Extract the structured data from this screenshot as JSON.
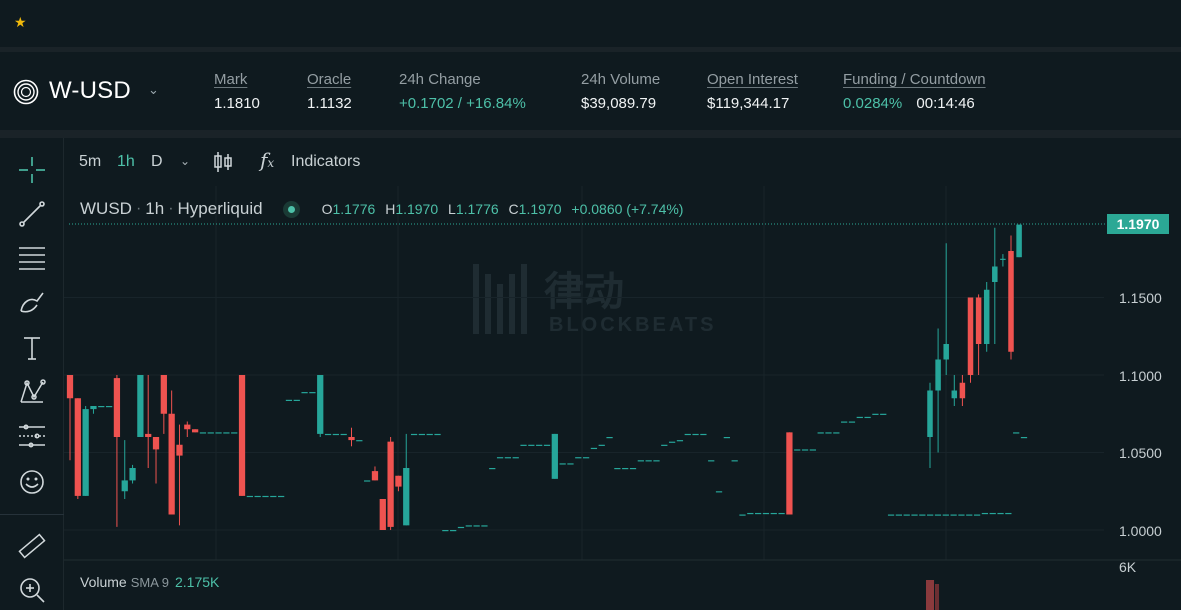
{
  "favorites": {
    "star_glyph": "★"
  },
  "market": {
    "symbol": "W-USD",
    "stats": [
      {
        "label": "Mark",
        "value": "1.1810"
      },
      {
        "label": "Oracle",
        "value": "1.1132"
      },
      {
        "label": "24h Change",
        "value": "+0.1702 / +16.84%"
      },
      {
        "label": "24h Volume",
        "value": "$39,089.79"
      },
      {
        "label": "Open Interest",
        "value": "$119,344.17"
      },
      {
        "label": "Funding / Countdown",
        "value": "0.0284%",
        "countdown": "00:14:46"
      }
    ]
  },
  "toolbar": {
    "tools": [
      "crosshair-icon",
      "trend-line-icon",
      "horizontal-lines-icon",
      "brush-icon",
      "text-icon",
      "pattern-icon",
      "prediction-icon",
      "emoji-icon",
      "ruler-icon",
      "zoom-in-icon"
    ]
  },
  "intervals": {
    "options": [
      "5m",
      "1h",
      "D"
    ],
    "active": "1h",
    "indicators_label": "Indicators"
  },
  "chart": {
    "legend": {
      "symbol": "WUSD",
      "interval": "1h",
      "exchange": "Hyperliquid",
      "o": "1.1776",
      "h": "1.1970",
      "l": "1.1776",
      "c": "1.1970",
      "change": "+0.0860 (+7.74%)"
    },
    "last_price_tag": "1.1970",
    "volume_legend": {
      "label": "Volume",
      "sma": "SMA 9",
      "value": "2.175K"
    },
    "watermark": "BLOCKBEATS",
    "watermark_cjk": "律动"
  },
  "chart_data": {
    "type": "candlestick",
    "y_ticks": [
      "1.1500",
      "1.1000",
      "1.0500",
      "1.0000"
    ],
    "volume_tick": "6K",
    "colors": {
      "up": "#26a69a",
      "down": "#ef5350"
    },
    "candles": [
      [
        1.1,
        1.1,
        1.045,
        1.085
      ],
      [
        1.085,
        1.085,
        1.02,
        1.022
      ],
      [
        1.022,
        1.08,
        1.022,
        1.078
      ],
      [
        1.078,
        1.08,
        1.075,
        1.08
      ],
      [
        1.08,
        1.08,
        1.08,
        1.08
      ],
      [
        1.08,
        1.08,
        1.08,
        1.08
      ],
      [
        1.098,
        1.1,
        1.002,
        1.06
      ],
      [
        1.025,
        1.058,
        1.02,
        1.032
      ],
      [
        1.032,
        1.042,
        1.03,
        1.04
      ],
      [
        1.06,
        1.09,
        1.06,
        1.1
      ],
      [
        1.062,
        1.1,
        1.04,
        1.06
      ],
      [
        1.06,
        1.06,
        1.03,
        1.052
      ],
      [
        1.1,
        1.1,
        1.062,
        1.075
      ],
      [
        1.075,
        1.09,
        1.01,
        1.01
      ],
      [
        1.055,
        1.068,
        1.003,
        1.048
      ],
      [
        1.068,
        1.07,
        1.06,
        1.065
      ],
      [
        1.065,
        1.065,
        1.063,
        1.063
      ],
      [
        1.063,
        1.063,
        1.063,
        1.063
      ],
      [
        1.063,
        1.063,
        1.063,
        1.063
      ],
      [
        1.063,
        1.063,
        1.063,
        1.063
      ],
      [
        1.063,
        1.063,
        1.063,
        1.063
      ],
      [
        1.063,
        1.063,
        1.063,
        1.063
      ],
      [
        1.1,
        1.1,
        1.022,
        1.022
      ],
      [
        1.022,
        1.022,
        1.022,
        1.022
      ],
      [
        1.022,
        1.022,
        1.022,
        1.022
      ],
      [
        1.022,
        1.022,
        1.022,
        1.022
      ],
      [
        1.022,
        1.022,
        1.022,
        1.022
      ],
      [
        1.022,
        1.022,
        1.022,
        1.022
      ],
      [
        1.084,
        1.084,
        1.084,
        1.084
      ],
      [
        1.084,
        1.084,
        1.084,
        1.084
      ],
      [
        1.089,
        1.089,
        1.089,
        1.089
      ],
      [
        1.089,
        1.089,
        1.089,
        1.089
      ],
      [
        1.062,
        1.1,
        1.06,
        1.1
      ],
      [
        1.062,
        1.062,
        1.062,
        1.062
      ],
      [
        1.062,
        1.062,
        1.062,
        1.062
      ],
      [
        1.062,
        1.062,
        1.062,
        1.062
      ],
      [
        1.06,
        1.066,
        1.054,
        1.058
      ],
      [
        1.058,
        1.058,
        1.058,
        1.058
      ],
      [
        1.032,
        1.032,
        1.032,
        1.032
      ],
      [
        1.038,
        1.041,
        1.032,
        1.032
      ],
      [
        1.02,
        1.02,
        1.0,
        1.0
      ],
      [
        1.057,
        1.06,
        1.0,
        1.002
      ],
      [
        1.035,
        1.035,
        1.025,
        1.028
      ],
      [
        1.003,
        1.062,
        1.003,
        1.04
      ],
      [
        1.062,
        1.062,
        1.062,
        1.062
      ],
      [
        1.062,
        1.062,
        1.062,
        1.062
      ],
      [
        1.062,
        1.062,
        1.062,
        1.062
      ],
      [
        1.062,
        1.062,
        1.062,
        1.062
      ],
      [
        1.0,
        1.0,
        1.0,
        1.0
      ],
      [
        1.0,
        1.0,
        1.0,
        1.0
      ],
      [
        1.002,
        1.002,
        1.002,
        1.002
      ],
      [
        1.003,
        1.003,
        1.003,
        1.003
      ],
      [
        1.003,
        1.003,
        1.003,
        1.003
      ],
      [
        1.003,
        1.003,
        1.003,
        1.003
      ],
      [
        1.04,
        1.04,
        1.04,
        1.04
      ],
      [
        1.047,
        1.047,
        1.047,
        1.047
      ],
      [
        1.047,
        1.047,
        1.047,
        1.047
      ],
      [
        1.047,
        1.047,
        1.047,
        1.047
      ],
      [
        1.055,
        1.055,
        1.055,
        1.055
      ],
      [
        1.055,
        1.055,
        1.055,
        1.055
      ],
      [
        1.055,
        1.055,
        1.055,
        1.055
      ],
      [
        1.055,
        1.055,
        1.055,
        1.055
      ],
      [
        1.033,
        1.062,
        1.033,
        1.062
      ],
      [
        1.043,
        1.043,
        1.043,
        1.043
      ],
      [
        1.043,
        1.043,
        1.043,
        1.043
      ],
      [
        1.047,
        1.047,
        1.047,
        1.047
      ],
      [
        1.047,
        1.047,
        1.047,
        1.047
      ],
      [
        1.053,
        1.053,
        1.053,
        1.053
      ],
      [
        1.055,
        1.055,
        1.055,
        1.055
      ],
      [
        1.06,
        1.06,
        1.06,
        1.06
      ],
      [
        1.04,
        1.04,
        1.04,
        1.04
      ],
      [
        1.04,
        1.04,
        1.04,
        1.04
      ],
      [
        1.04,
        1.04,
        1.04,
        1.04
      ],
      [
        1.045,
        1.045,
        1.045,
        1.045
      ],
      [
        1.045,
        1.045,
        1.045,
        1.045
      ],
      [
        1.045,
        1.045,
        1.045,
        1.045
      ],
      [
        1.055,
        1.055,
        1.055,
        1.055
      ],
      [
        1.057,
        1.057,
        1.057,
        1.057
      ],
      [
        1.058,
        1.058,
        1.058,
        1.058
      ],
      [
        1.062,
        1.062,
        1.062,
        1.062
      ],
      [
        1.062,
        1.062,
        1.062,
        1.062
      ],
      [
        1.062,
        1.062,
        1.062,
        1.062
      ],
      [
        1.045,
        1.045,
        1.045,
        1.045
      ],
      [
        1.025,
        1.025,
        1.025,
        1.025
      ],
      [
        1.06,
        1.06,
        1.06,
        1.06
      ],
      [
        1.045,
        1.045,
        1.045,
        1.045
      ],
      [
        1.01,
        1.01,
        1.01,
        1.01
      ],
      [
        1.011,
        1.011,
        1.011,
        1.011
      ],
      [
        1.011,
        1.011,
        1.011,
        1.011
      ],
      [
        1.011,
        1.011,
        1.011,
        1.011
      ],
      [
        1.011,
        1.011,
        1.011,
        1.011
      ],
      [
        1.011,
        1.011,
        1.011,
        1.011
      ],
      [
        1.063,
        1.063,
        1.01,
        1.01
      ],
      [
        1.052,
        1.052,
        1.052,
        1.052
      ],
      [
        1.052,
        1.052,
        1.052,
        1.052
      ],
      [
        1.052,
        1.052,
        1.052,
        1.052
      ],
      [
        1.063,
        1.063,
        1.063,
        1.063
      ],
      [
        1.063,
        1.063,
        1.063,
        1.063
      ],
      [
        1.063,
        1.063,
        1.063,
        1.063
      ],
      [
        1.07,
        1.07,
        1.07,
        1.07
      ],
      [
        1.07,
        1.07,
        1.07,
        1.07
      ],
      [
        1.073,
        1.073,
        1.073,
        1.073
      ],
      [
        1.073,
        1.073,
        1.073,
        1.073
      ],
      [
        1.075,
        1.075,
        1.075,
        1.075
      ],
      [
        1.075,
        1.075,
        1.075,
        1.075
      ],
      [
        1.01,
        1.01,
        1.01,
        1.01
      ],
      [
        1.01,
        1.01,
        1.01,
        1.01
      ],
      [
        1.01,
        1.01,
        1.01,
        1.01
      ],
      [
        1.01,
        1.01,
        1.01,
        1.01
      ],
      [
        1.01,
        1.01,
        1.01,
        1.01
      ],
      [
        1.01,
        1.01,
        1.01,
        1.01
      ],
      [
        1.01,
        1.01,
        1.01,
        1.01
      ],
      [
        1.01,
        1.01,
        1.01,
        1.01
      ],
      [
        1.01,
        1.01,
        1.01,
        1.01
      ],
      [
        1.01,
        1.01,
        1.01,
        1.01
      ],
      [
        1.01,
        1.01,
        1.01,
        1.01
      ],
      [
        1.01,
        1.01,
        1.01,
        1.01
      ],
      [
        1.011,
        1.011,
        1.011,
        1.011
      ],
      [
        1.011,
        1.011,
        1.011,
        1.011
      ],
      [
        1.011,
        1.011,
        1.011,
        1.011
      ],
      [
        1.011,
        1.011,
        1.011,
        1.011
      ],
      [
        1.063,
        1.063,
        1.063,
        1.063
      ],
      [
        1.06,
        1.06,
        1.06,
        1.06
      ]
    ]
  }
}
